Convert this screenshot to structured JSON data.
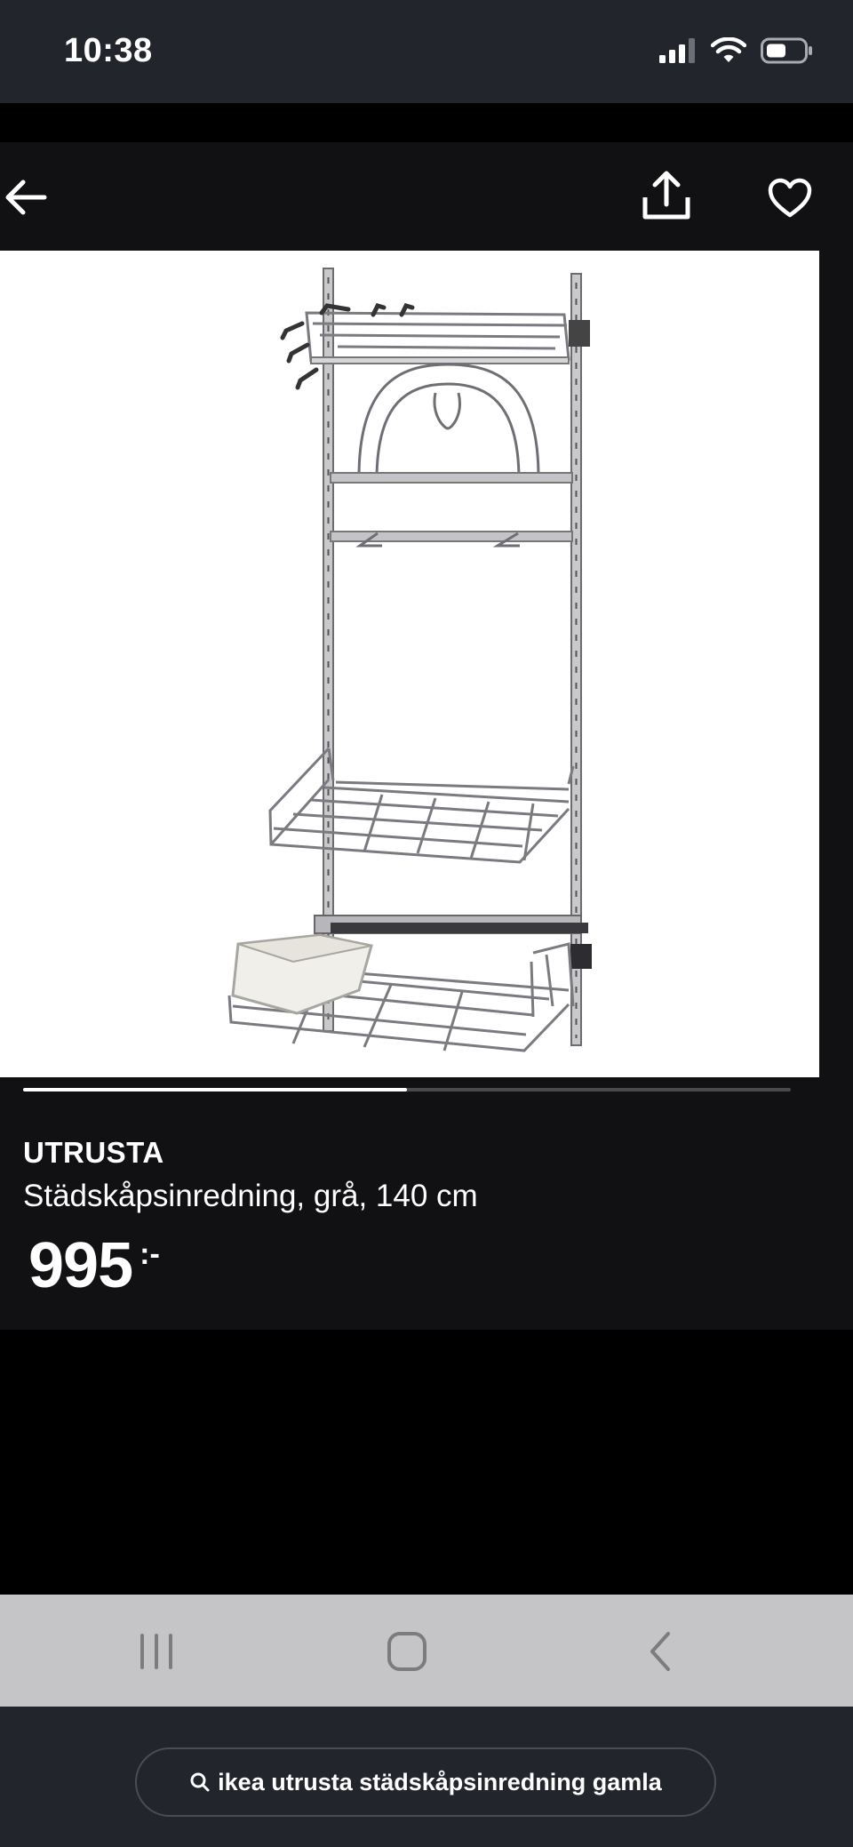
{
  "status_bar": {
    "time": "10:38"
  },
  "header": {
    "icons": [
      "arrow-left-icon",
      "share-icon",
      "heart-icon"
    ]
  },
  "carousel": {
    "progress": 0.5
  },
  "product": {
    "name": "UTRUSTA",
    "description": "Städskåpsinredning, grå, 140 cm",
    "price": "995",
    "price_suffix": ":-"
  },
  "bottom_bar": {
    "url_text": "ikea utrusta städskåpsinredning gamla"
  },
  "colors": {
    "status_bg": "#23252c",
    "header_bg": "#111113",
    "nav_bar_bg": "#c5c5c7",
    "image_bg": "#ffffff"
  }
}
